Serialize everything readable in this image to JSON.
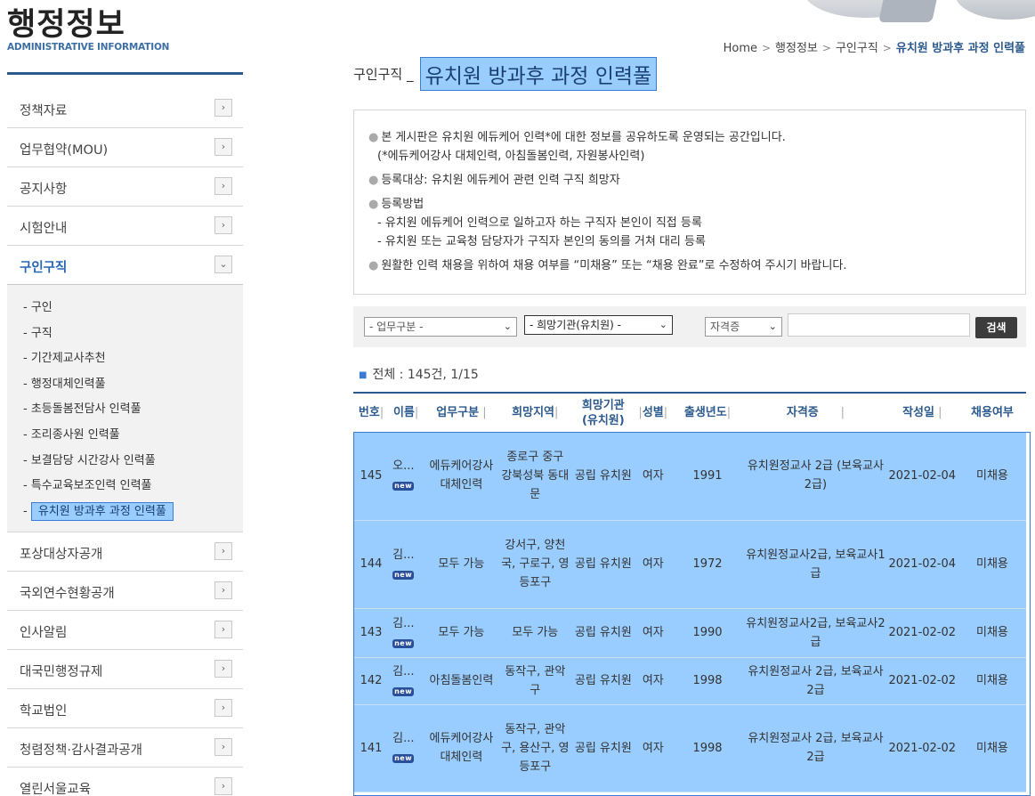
{
  "site": {
    "title_ko": "행정정보",
    "title_en": "ADMINISTRATIVE INFORMATION"
  },
  "sidebar": {
    "items_top": [
      {
        "label": "정책자료"
      },
      {
        "label": "업무협약(MOU)"
      },
      {
        "label": "공지사항"
      },
      {
        "label": "시험안내"
      }
    ],
    "active": {
      "label": "구인구직"
    },
    "sub_items": [
      {
        "label": "- 구인"
      },
      {
        "label": "- 구직"
      },
      {
        "label": "- 기간제교사추천"
      },
      {
        "label": "- 행정대체인력풀"
      },
      {
        "label": "- 초등돌봄전담사 인력풀"
      },
      {
        "label": "- 조리종사원 인력풀"
      },
      {
        "label": "- 보결담당 시간강사 인력풀"
      },
      {
        "label": "- 특수교육보조인력 인력풀"
      },
      {
        "label": "유치원 방과후 과정 인력풀"
      }
    ],
    "items_bottom": [
      {
        "label": "포상대상자공개"
      },
      {
        "label": "국외연수현황공개"
      },
      {
        "label": "인사알림"
      },
      {
        "label": "대국민행정규제"
      },
      {
        "label": "학교법인"
      },
      {
        "label": "청렴정책·감사결과공개"
      },
      {
        "label": "열린서울교육"
      }
    ],
    "arrow_closed": "›",
    "arrow_open": "⌄"
  },
  "breadcrumb": {
    "home": "Home",
    "level1": "행정정보",
    "level2": "구인구직",
    "current": "유치원 방과후 과정 인력풀",
    "separator": ">"
  },
  "heading": {
    "prefix": "구인구직 _",
    "title": "유치원 방과후 과정 인력풀"
  },
  "notice": {
    "line1": "본 게시판은 유치원 에듀케어 인력*에 대한 정보를 공유하도록 운영되는 공간입니다.",
    "line1b": "(*에듀케어강사 대체인력, 아침돌봄인력, 자원봉사인력)",
    "line2": "등록대상: 유치원 에듀케어 관련 인력 구직 희망자",
    "line3": "등록방법",
    "line3a": "- 유치원 에듀케어 인력으로 일하고자 하는 구직자 본인이 직접 등록",
    "line3b": "- 유치원 또는 교육청 담당자가 구직자 본인의 동의를 거쳐 대리 등록",
    "line4": "원활한 인력 채용을 위하여 채용 여부를 “미채용” 또는 “채용 완료”로 수정하여 주시기 바랍니다.",
    "bullet": "●"
  },
  "search": {
    "filter1": "- 업무구분 -",
    "filter2": "- 희망기관(유치원) -",
    "filter3": "자격증",
    "button": "검색",
    "query": ""
  },
  "summary": {
    "text": "전체 : 145건, 1/15"
  },
  "table": {
    "columns": [
      "번호",
      "이름",
      "업무구분",
      "희망지역",
      "희망기관\n(유치원)",
      "성별",
      "출생년도",
      "자격증",
      "작성일",
      "채용여부"
    ],
    "new_badge": "new",
    "rows": [
      {
        "no": "145",
        "name": "오...",
        "job": "에듀케어강사 대체인력",
        "region": "종로구 중구 강북성북 동대문",
        "org": "공립 유치원",
        "sex": "여자",
        "year": "1991",
        "cert": "유치원정교사 2급 (보육교사2급)",
        "date": "2021-02-04",
        "hired": "미채용"
      },
      {
        "no": "144",
        "name": "김...",
        "job": "모두 가능",
        "region": "강서구, 양천국, 구로구, 영등포구",
        "org": "공립 유치원",
        "sex": "여자",
        "year": "1972",
        "cert": "유치원정교사2급, 보육교사1급",
        "date": "2021-02-04",
        "hired": "미채용"
      },
      {
        "no": "143",
        "name": "김...",
        "job": "모두 가능",
        "region": "모두 가능",
        "org": "공립 유치원",
        "sex": "여자",
        "year": "1990",
        "cert": "유치원정교사2급, 보육교사2급",
        "date": "2021-02-02",
        "hired": "미채용"
      },
      {
        "no": "142",
        "name": "김...",
        "job": "아침돌봄인력",
        "region": "동작구, 관악구",
        "org": "공립 유치원",
        "sex": "여자",
        "year": "1998",
        "cert": "유치원정교사 2급, 보육교사 2급",
        "date": "2021-02-02",
        "hired": "미채용"
      },
      {
        "no": "141",
        "name": "김...",
        "job": "에듀케어강사 대체인력",
        "region": "동작구, 관악구, 용산구, 영등포구",
        "org": "공립 유치원",
        "sex": "여자",
        "year": "1998",
        "cert": "유치원정교사 2급, 보육교사 2급",
        "date": "2021-02-02",
        "hired": "미채용"
      }
    ]
  },
  "colors": {
    "accent": "#2c5a8c",
    "selection": "#99ccff",
    "active_menu": "#2566b5"
  }
}
